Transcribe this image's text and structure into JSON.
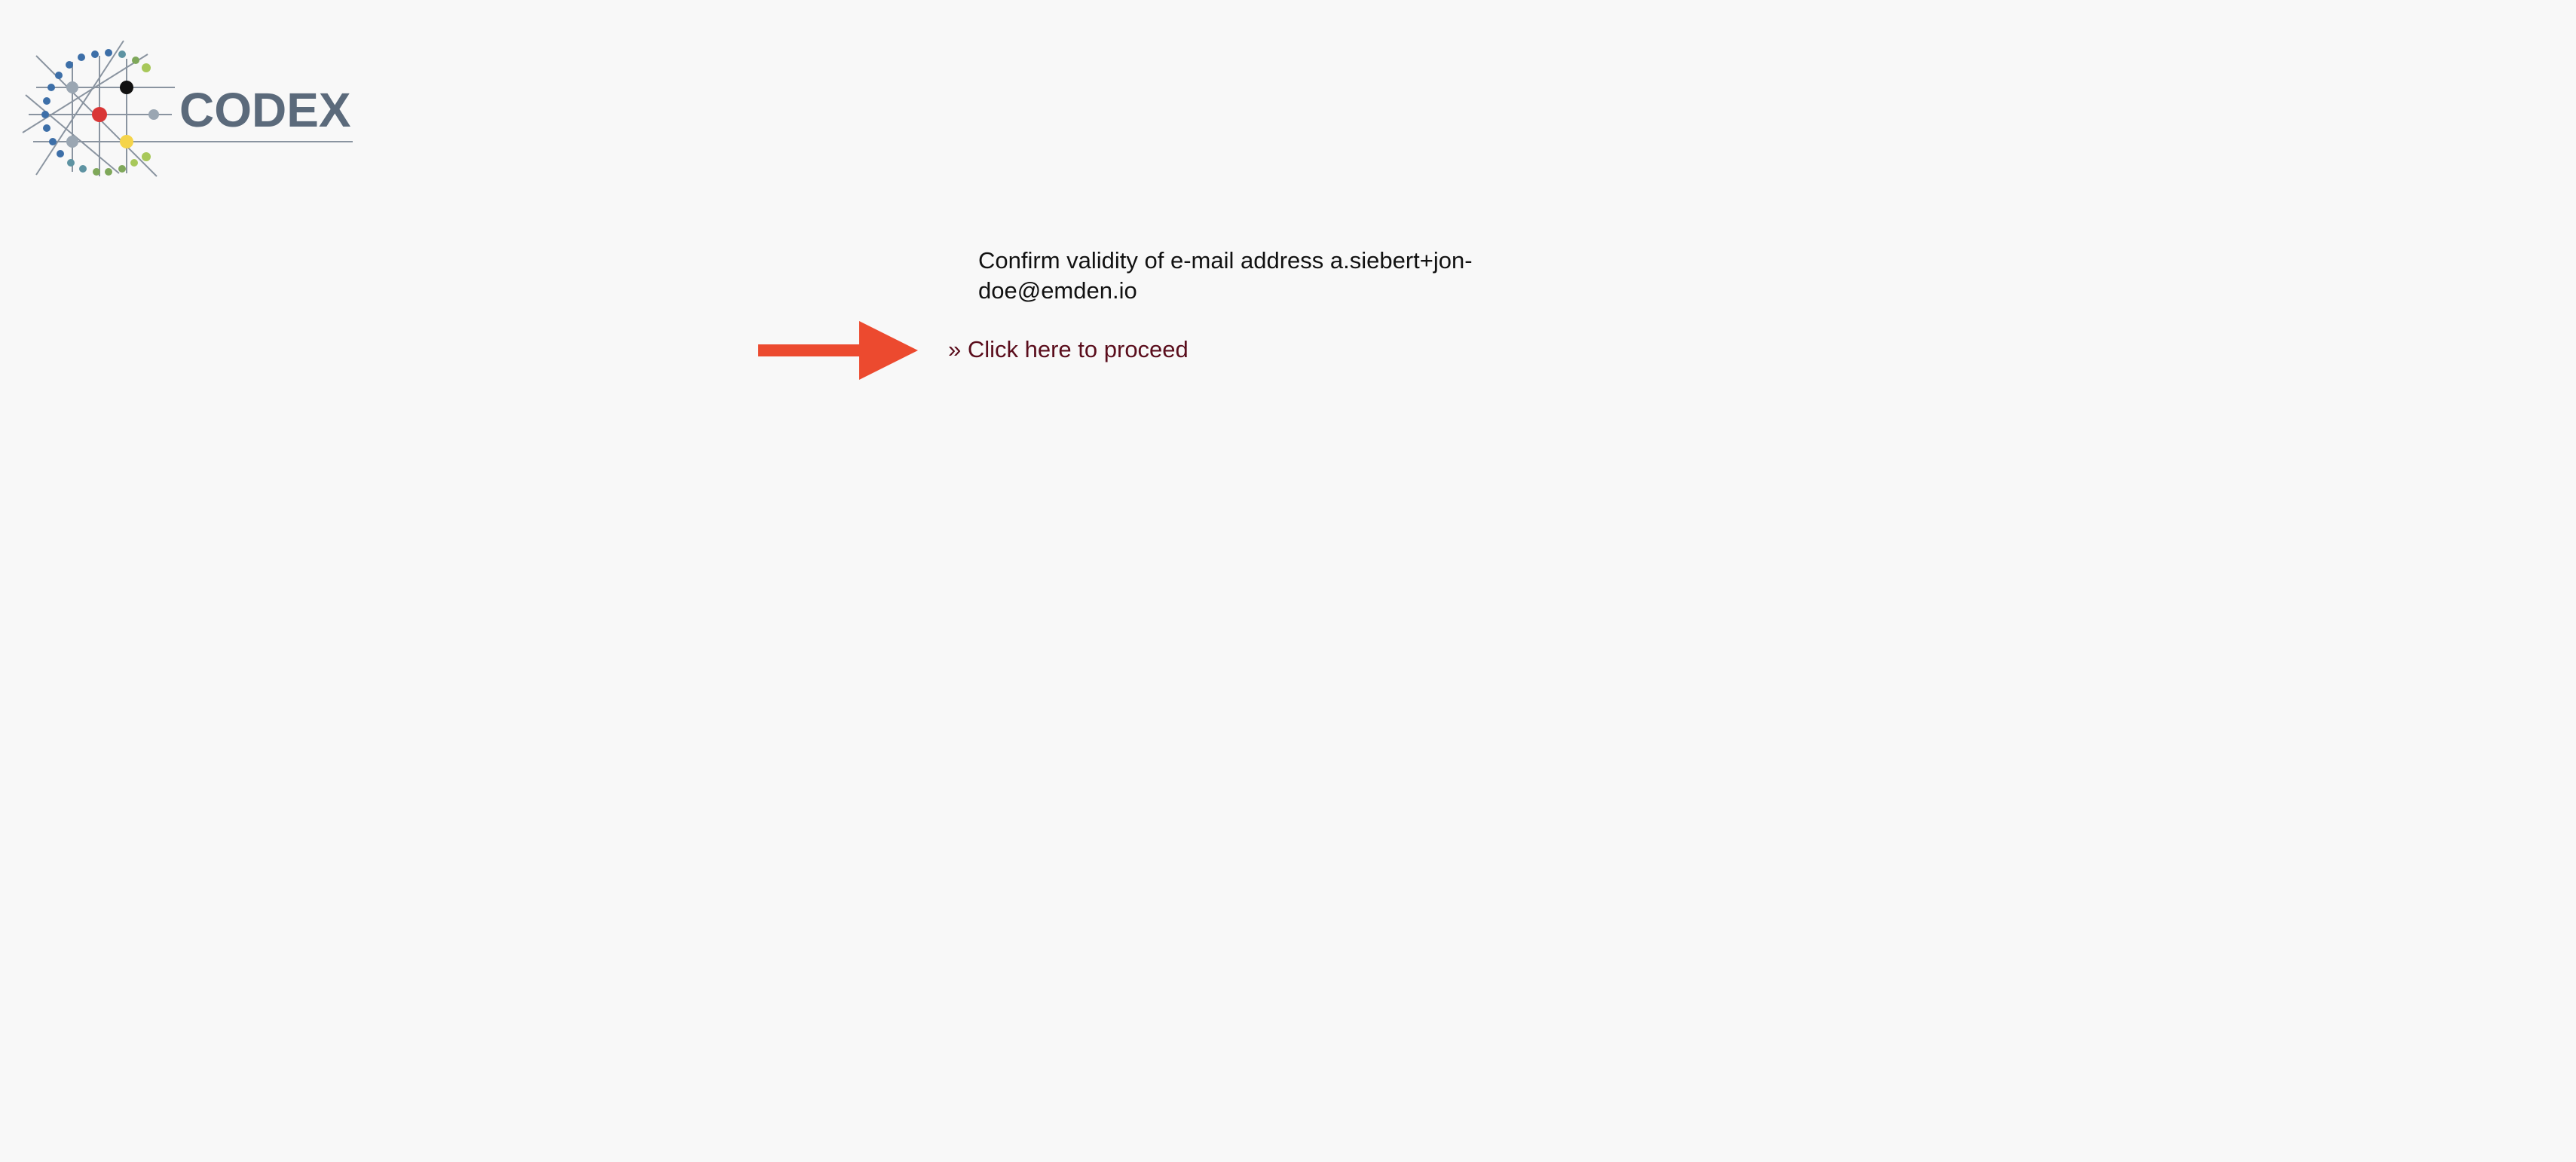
{
  "logo": {
    "text": "CODEX",
    "text_color": "#5b6a7b",
    "dot_colors": {
      "blue": "#3d6fa8",
      "teal": "#5e93a2",
      "green": "#7fa85a",
      "light_green": "#a8c85a",
      "red": "#d93636",
      "black": "#111111",
      "yellow": "#f5d44a",
      "gray": "#9aa6b2"
    }
  },
  "message": {
    "text": "Confirm validity of e-mail address a.siebert+jon-doe@emden.io"
  },
  "proceed": {
    "label": "» Click here to proceed",
    "color": "#5a0d1c"
  },
  "arrow": {
    "icon": "right-arrow-icon",
    "color": "#ec4a2f"
  }
}
